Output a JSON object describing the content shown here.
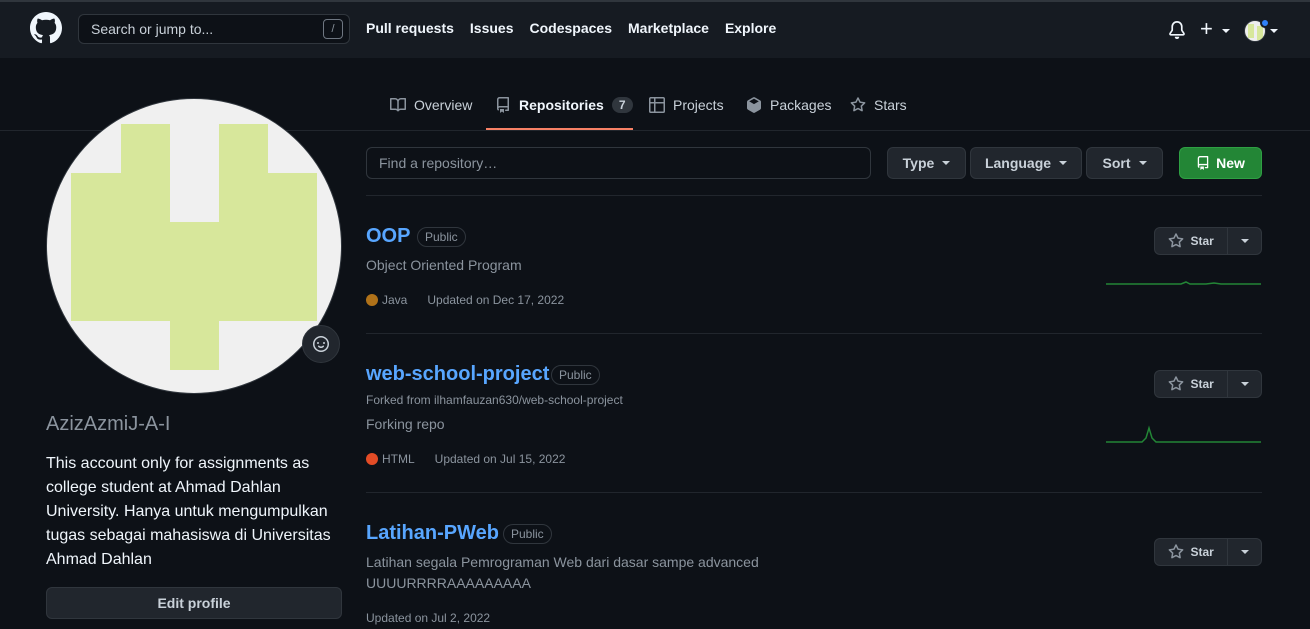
{
  "header": {
    "search_placeholder": "Search or jump to...",
    "search_shortcut": "/",
    "nav": [
      "Pull requests",
      "Issues",
      "Codespaces",
      "Marketplace",
      "Explore"
    ]
  },
  "tabs": [
    {
      "label": "Overview",
      "icon": "book-icon"
    },
    {
      "label": "Repositories",
      "icon": "repo-icon",
      "count": "7",
      "active": true
    },
    {
      "label": "Projects",
      "icon": "table-icon"
    },
    {
      "label": "Packages",
      "icon": "package-icon"
    },
    {
      "label": "Stars",
      "icon": "star-icon"
    }
  ],
  "profile": {
    "username": "AzizAzmiJ-A-I",
    "bio": "This account only for assignments as college student at Ahmad Dahlan University. Hanya untuk mengumpulkan tugas sebagai mahasiswa di Universitas Ahmad Dahlan",
    "edit_label": "Edit profile"
  },
  "filters": {
    "find_placeholder": "Find a repository…",
    "type_label": "Type",
    "language_label": "Language",
    "sort_label": "Sort",
    "new_label": "New"
  },
  "repos": [
    {
      "name": "OOP",
      "visibility": "Public",
      "forked_from": "",
      "description": "Object Oriented Program",
      "language": "Java",
      "language_color": "#b07219",
      "updated": "Updated on Dec 17, 2022",
      "star_label": "Star"
    },
    {
      "name": "web-school-project",
      "visibility": "Public",
      "forked_from": "Forked from ilhamfauzan630/web-school-project",
      "description": "Forking repo",
      "language": "HTML",
      "language_color": "#e34c26",
      "updated": "Updated on Jul 15, 2022",
      "star_label": "Star"
    },
    {
      "name": "Latihan-PWeb",
      "visibility": "Public",
      "forked_from": "",
      "description": "Latihan segala Pemrograman Web dari dasar sampe advanced",
      "description_line2": "UUUURRRRAAAAAAAAA",
      "language": "",
      "updated": "Updated on Jul 2, 2022",
      "star_label": "Star"
    }
  ],
  "colors": {
    "background": "#0d1117",
    "header": "#161b22",
    "link": "#58a6ff",
    "new_button": "#238636",
    "tab_underline": "#f78166",
    "avatar_pixels": "#d7e79b"
  }
}
